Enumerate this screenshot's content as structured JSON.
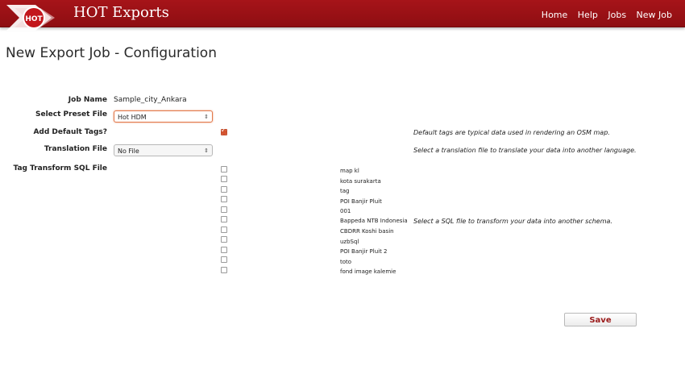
{
  "header": {
    "logo_text": "HOT",
    "brand": "HOT Exports",
    "nav": [
      "Home",
      "Help",
      "Jobs",
      "New Job"
    ]
  },
  "page_title": "New Export Job - Configuration",
  "form": {
    "job_name_label": "Job Name",
    "job_name_value": "Sample_city_Ankara",
    "preset_label": "Select Preset File",
    "preset_value": "Hot HDM",
    "default_tags_label": "Add Default Tags?",
    "default_tags_checked": true,
    "default_tags_help": "Default tags are typical data used in rendering an OSM map.",
    "translation_label": "Translation File",
    "translation_value": "No File",
    "translation_help": "Select a translation file to translate your data into another language.",
    "sql_label": "Tag Transform SQL File",
    "sql_help": "Select a SQL file to transform your data into another schema.",
    "sql_files": [
      "map kl",
      "kota surakarta",
      "tag",
      "POI Banjir Pluit",
      "001",
      "Bappeda NTB Indonesia",
      "CBDRR Koshi basin",
      "uzbSql",
      "POI Banjir Pluit 2",
      "toto",
      "fond image kalemie"
    ],
    "save_label": "Save"
  },
  "colors": {
    "header": "#9b1116",
    "accent": "#d4532f"
  }
}
